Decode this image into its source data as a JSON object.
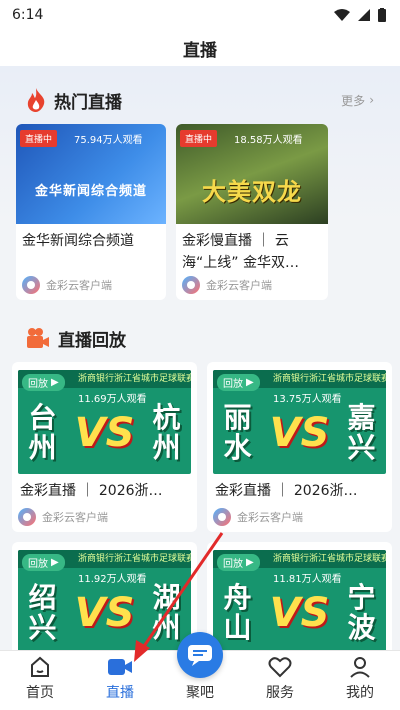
{
  "status": {
    "time": "6:14"
  },
  "header": {
    "title": "直播"
  },
  "hot": {
    "title": "热门直播",
    "more": "更多",
    "cards": [
      {
        "badge": "直播中",
        "viewers": "75.94万人观看",
        "caption": "金华新闻综合频道",
        "title": "金华新闻综合频道",
        "source": "金彩云客户端"
      },
      {
        "badge": "直播中",
        "viewers": "18.58万人观看",
        "caption": "大美双龙",
        "title": "金彩慢直播 ｜ 云海“上线” 金华双…",
        "source": "金彩云客户端"
      }
    ]
  },
  "replay": {
    "title": "直播回放",
    "strip": "浙商银行浙江省城市足球联赛",
    "badge": "回放",
    "vs": "VS",
    "cards": [
      {
        "viewers": "11.69万人观看",
        "team_a": "台州",
        "team_b": "杭州",
        "title": "金彩直播 ｜ 2026浙…",
        "source": "金彩云客户端"
      },
      {
        "viewers": "13.75万人观看",
        "team_a": "丽水",
        "team_b": "嘉兴",
        "title": "金彩直播 ｜ 2026浙…",
        "source": "金彩云客户端"
      },
      {
        "viewers": "11.92万人观看",
        "team_a": "绍兴",
        "team_b": "湖州",
        "title": "",
        "source": ""
      },
      {
        "viewers": "11.81万人观看",
        "team_a": "舟山",
        "team_b": "宁波",
        "title": "",
        "source": ""
      }
    ]
  },
  "tabs": [
    {
      "label": "首页",
      "icon": "home-icon"
    },
    {
      "label": "直播",
      "icon": "video-icon"
    },
    {
      "label": "聚吧",
      "icon": "chat-icon"
    },
    {
      "label": "服务",
      "icon": "heart-icon"
    },
    {
      "label": "我的",
      "icon": "user-icon"
    }
  ],
  "colors": {
    "accent": "#2a6fdb",
    "live": "#e63b2e",
    "replay_green": "#17956e"
  }
}
